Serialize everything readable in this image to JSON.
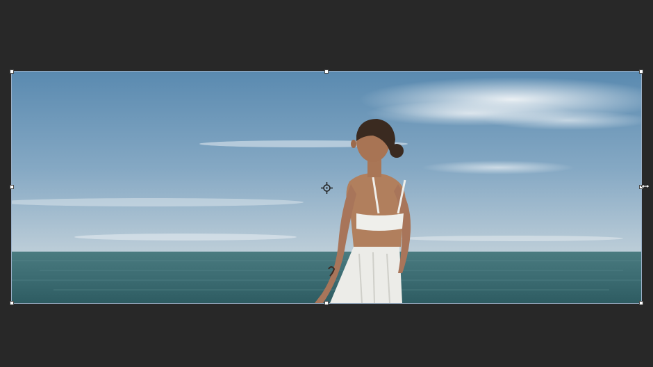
{
  "editor": {
    "tool": "free-transform",
    "canvas_background": "#282828"
  },
  "image_layer": {
    "description_icon": "photo-layer",
    "colors": {
      "sky_top": "#5f8fb5",
      "sky_horizon": "#b8cad6",
      "sea": "#3f6e74",
      "sea_dark": "#2f5a60",
      "skin": "#b07e5c",
      "garment": "#eeeeea",
      "hair": "#3a2a20"
    }
  },
  "transform_box": {
    "handle_color": "#ffffff",
    "frame_color": "#9ab0c8",
    "handle_count": 8
  },
  "icons": {
    "reference_point": "crosshair-target-icon",
    "cursor": "rotate-cursor-icon"
  }
}
